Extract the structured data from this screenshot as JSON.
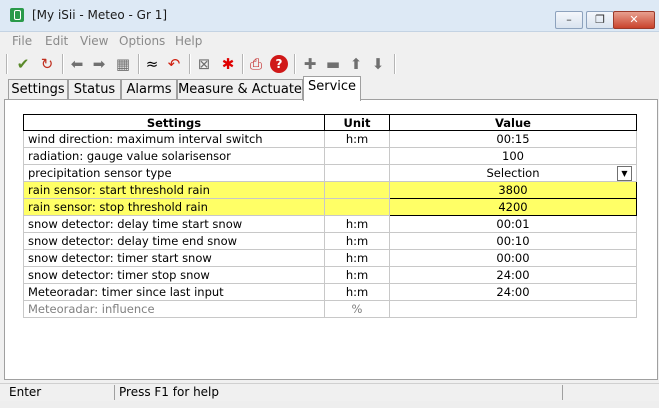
{
  "window": {
    "title": "[My iSii - Meteo - Gr 1]",
    "minimize_glyph": "–",
    "restore_glyph": "❐",
    "close_glyph": "✕"
  },
  "menu": [
    "File",
    "Edit",
    "View",
    "Options",
    "Help"
  ],
  "toolbar_icons": [
    "check-icon",
    "refresh-icon",
    "back-icon",
    "forward-icon",
    "grid-icon",
    "fold-icon",
    "undo-icon",
    "cancel-icon",
    "asterisk-icon",
    "print-icon",
    "help-icon",
    "plus-icon",
    "minus-icon",
    "up-icon",
    "down-icon"
  ],
  "tabs": [
    "Settings",
    "Status",
    "Alarms",
    "Measure & Actuate",
    "Service"
  ],
  "active_tab": "Service",
  "table": {
    "headers": {
      "setting": "Settings",
      "unit": "Unit",
      "value": "Value"
    },
    "rows": [
      {
        "setting": "wind direction: maximum interval switch",
        "unit": "h:m",
        "value": "00:15"
      },
      {
        "setting": "radiation: gauge value solarisensor",
        "unit": "",
        "value": "100"
      },
      {
        "setting": "precipitation sensor type",
        "unit": "",
        "value": "Selection"
      },
      {
        "setting": "rain sensor: start threshold rain",
        "unit": "",
        "value": "3800"
      },
      {
        "setting": "rain sensor: stop threshold rain",
        "unit": "",
        "value": "4200"
      },
      {
        "setting": "snow detector: delay time start snow",
        "unit": "h:m",
        "value": "00:01"
      },
      {
        "setting": "snow detector: delay time end snow",
        "unit": "h:m",
        "value": "00:10"
      },
      {
        "setting": "snow detector: timer start snow",
        "unit": "h:m",
        "value": "00:00"
      },
      {
        "setting": "snow detector: timer stop snow",
        "unit": "h:m",
        "value": "24:00"
      },
      {
        "setting": "Meteoradar: timer since last input",
        "unit": "h:m",
        "value": "24:00"
      },
      {
        "setting": "Meteoradar: influence",
        "unit": "%",
        "value": ""
      }
    ]
  },
  "colors": {
    "highlight": "#ffff66",
    "accent_red": "#e00000",
    "disabled_text": "#808080"
  },
  "status": {
    "left": "Enter",
    "right": "Press F1 for help"
  }
}
